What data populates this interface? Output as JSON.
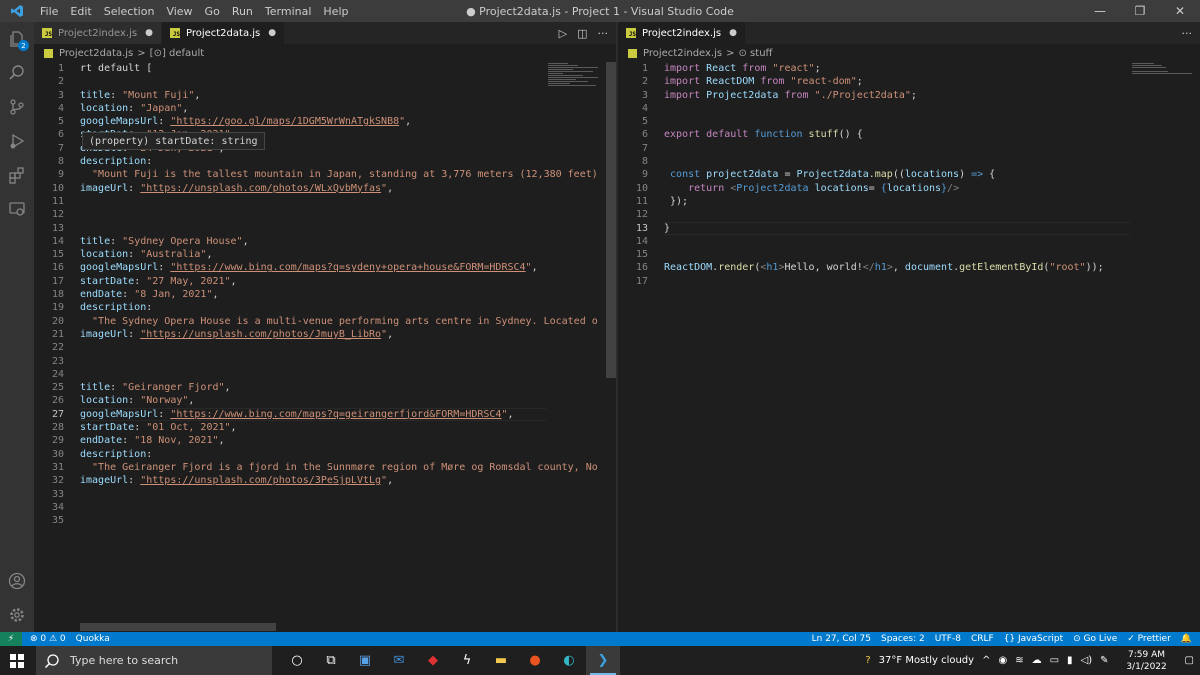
{
  "titlebar": {
    "menu": [
      "File",
      "Edit",
      "Selection",
      "View",
      "Go",
      "Run",
      "Terminal",
      "Help"
    ],
    "title": "● Project2data.js - Project 1 - Visual Studio Code",
    "controls": [
      "—",
      "❐",
      "✕"
    ]
  },
  "activity": {
    "explorer_badge": "2"
  },
  "left": {
    "tabs": [
      {
        "label": "Project2index.js",
        "dirty": "●"
      },
      {
        "label": "Project2data.js",
        "dirty": "●"
      }
    ],
    "actions": [
      "▷",
      "◫",
      "···"
    ],
    "breadcrumb": {
      "file": "Project2data.js",
      "sep": ">",
      "symbol": "[⊙] default"
    },
    "hover": "(property) startDate: string",
    "lines": [
      {
        "n": "1",
        "parts": [
          {
            "c": "p",
            "t": "rt default ["
          }
        ]
      },
      {
        "n": "2",
        "parts": []
      },
      {
        "n": "3",
        "parts": [
          {
            "c": "k",
            "t": "title"
          },
          {
            "c": "p",
            "t": ": "
          },
          {
            "c": "s",
            "t": "\"Mount Fuji\""
          },
          {
            "c": "p",
            "t": ","
          }
        ]
      },
      {
        "n": "4",
        "parts": [
          {
            "c": "k",
            "t": "location"
          },
          {
            "c": "p",
            "t": ": "
          },
          {
            "c": "s",
            "t": "\"Japan\""
          },
          {
            "c": "p",
            "t": ","
          }
        ]
      },
      {
        "n": "5",
        "parts": [
          {
            "c": "k",
            "t": "googleMapsUrl"
          },
          {
            "c": "p",
            "t": ": "
          },
          {
            "c": "u",
            "t": "\"https://goo.gl/maps/1DGM5WrWnATgkSNB8"
          },
          {
            "c": "s",
            "t": "\""
          },
          {
            "c": "p",
            "t": ","
          }
        ]
      },
      {
        "n": "6",
        "parts": [
          {
            "c": "k",
            "t": "startDate"
          },
          {
            "c": "p",
            "t": ": "
          },
          {
            "c": "s",
            "t": "\"12 Jan, 2021\""
          },
          {
            "c": "p",
            "t": ","
          }
        ]
      },
      {
        "n": "7",
        "parts": [
          {
            "c": "k",
            "t": "endDate"
          },
          {
            "c": "p",
            "t": ": "
          },
          {
            "c": "s",
            "t": "\"24 Jan, 2021\""
          },
          {
            "c": "p",
            "t": ","
          }
        ]
      },
      {
        "n": "8",
        "parts": [
          {
            "c": "k",
            "t": "description"
          },
          {
            "c": "p",
            "t": ":"
          }
        ]
      },
      {
        "n": "9",
        "parts": [
          {
            "c": "s",
            "t": "  \"Mount Fuji is the tallest mountain in Japan, standing at 3,776 meters (12,380 feet)"
          }
        ]
      },
      {
        "n": "10",
        "parts": [
          {
            "c": "k",
            "t": "imageUrl"
          },
          {
            "c": "p",
            "t": ": "
          },
          {
            "c": "u",
            "t": "\"https://unsplash.com/photos/WLxQvbMyfas"
          },
          {
            "c": "s",
            "t": "\""
          },
          {
            "c": "p",
            "t": ","
          }
        ]
      },
      {
        "n": "11",
        "parts": []
      },
      {
        "n": "12",
        "parts": []
      },
      {
        "n": "13",
        "parts": []
      },
      {
        "n": "14",
        "parts": [
          {
            "c": "k",
            "t": "title"
          },
          {
            "c": "p",
            "t": ": "
          },
          {
            "c": "s",
            "t": "\"Sydney Opera House\""
          },
          {
            "c": "p",
            "t": ","
          }
        ]
      },
      {
        "n": "15",
        "parts": [
          {
            "c": "k",
            "t": "location"
          },
          {
            "c": "p",
            "t": ": "
          },
          {
            "c": "s",
            "t": "\"Australia\""
          },
          {
            "c": "p",
            "t": ","
          }
        ]
      },
      {
        "n": "16",
        "parts": [
          {
            "c": "k",
            "t": "googleMapsUrl"
          },
          {
            "c": "p",
            "t": ": "
          },
          {
            "c": "u",
            "t": "\"https://www.bing.com/maps?q=sydeny+opera+house&FORM=HDRSC4"
          },
          {
            "c": "s",
            "t": "\""
          },
          {
            "c": "p",
            "t": ","
          }
        ]
      },
      {
        "n": "17",
        "parts": [
          {
            "c": "k",
            "t": "startDate"
          },
          {
            "c": "p",
            "t": ": "
          },
          {
            "c": "s",
            "t": "\"27 May, 2021\""
          },
          {
            "c": "p",
            "t": ","
          }
        ]
      },
      {
        "n": "18",
        "parts": [
          {
            "c": "k",
            "t": "endDate"
          },
          {
            "c": "p",
            "t": ": "
          },
          {
            "c": "s",
            "t": "\"8 Jan, 2021\""
          },
          {
            "c": "p",
            "t": ","
          }
        ]
      },
      {
        "n": "19",
        "parts": [
          {
            "c": "k",
            "t": "description"
          },
          {
            "c": "p",
            "t": ":"
          }
        ]
      },
      {
        "n": "20",
        "parts": [
          {
            "c": "s",
            "t": "  \"The Sydney Opera House is a multi-venue performing arts centre in Sydney. Located o"
          }
        ]
      },
      {
        "n": "21",
        "parts": [
          {
            "c": "k",
            "t": "imageUrl"
          },
          {
            "c": "p",
            "t": ": "
          },
          {
            "c": "u",
            "t": "\"https://unsplash.com/photos/JmuyB_LibRo"
          },
          {
            "c": "s",
            "t": "\""
          },
          {
            "c": "p",
            "t": ","
          }
        ]
      },
      {
        "n": "22",
        "parts": []
      },
      {
        "n": "23",
        "parts": []
      },
      {
        "n": "24",
        "parts": []
      },
      {
        "n": "25",
        "parts": [
          {
            "c": "k",
            "t": "title"
          },
          {
            "c": "p",
            "t": ": "
          },
          {
            "c": "s",
            "t": "\"Geiranger Fjord\""
          },
          {
            "c": "p",
            "t": ","
          }
        ]
      },
      {
        "n": "26",
        "parts": [
          {
            "c": "k",
            "t": "location"
          },
          {
            "c": "p",
            "t": ": "
          },
          {
            "c": "s",
            "t": "\"Norway\""
          },
          {
            "c": "p",
            "t": ","
          }
        ]
      },
      {
        "n": "27",
        "parts": [
          {
            "c": "k",
            "t": "googleMapsUrl"
          },
          {
            "c": "p",
            "t": ": "
          },
          {
            "c": "u",
            "t": "\"https://www.bing.com/maps?q=geirangerfjord&FORM=HDRSC4"
          },
          {
            "c": "s",
            "t": "\""
          },
          {
            "c": "p",
            "t": ","
          }
        ]
      },
      {
        "n": "28",
        "parts": [
          {
            "c": "k",
            "t": "startDate"
          },
          {
            "c": "p",
            "t": ": "
          },
          {
            "c": "s",
            "t": "\"01 Oct, 2021\""
          },
          {
            "c": "p",
            "t": ","
          }
        ]
      },
      {
        "n": "29",
        "parts": [
          {
            "c": "k",
            "t": "endDate"
          },
          {
            "c": "p",
            "t": ": "
          },
          {
            "c": "s",
            "t": "\"18 Nov, 2021\""
          },
          {
            "c": "p",
            "t": ","
          }
        ]
      },
      {
        "n": "30",
        "parts": [
          {
            "c": "k",
            "t": "description"
          },
          {
            "c": "p",
            "t": ":"
          }
        ]
      },
      {
        "n": "31",
        "parts": [
          {
            "c": "s",
            "t": "  \"The Geiranger Fjord is a fjord in the Sunnmøre region of Møre og Romsdal county, No"
          }
        ]
      },
      {
        "n": "32",
        "parts": [
          {
            "c": "k",
            "t": "imageUrl"
          },
          {
            "c": "p",
            "t": ": "
          },
          {
            "c": "u",
            "t": "\"https://unsplash.com/photos/3PeSjpLVtLg"
          },
          {
            "c": "s",
            "t": "\""
          },
          {
            "c": "p",
            "t": ","
          }
        ]
      },
      {
        "n": "33",
        "parts": []
      },
      {
        "n": "34",
        "parts": []
      },
      {
        "n": "35",
        "parts": []
      }
    ],
    "current_line": "27"
  },
  "right": {
    "tabs": [
      {
        "label": "Project2index.js",
        "dirty": "●"
      }
    ],
    "actions": [
      "···"
    ],
    "breadcrumb": {
      "file": "Project2index.js",
      "sep": ">",
      "symbol": "⊙ stuff"
    },
    "lines": [
      {
        "n": "1",
        "parts": [
          {
            "c": "kc",
            "t": "import"
          },
          {
            "c": "p",
            "t": " "
          },
          {
            "c": "k",
            "t": "React"
          },
          {
            "c": "p",
            "t": " "
          },
          {
            "c": "kc",
            "t": "from"
          },
          {
            "c": "p",
            "t": " "
          },
          {
            "c": "s",
            "t": "\"react\""
          },
          {
            "c": "p",
            "t": ";"
          }
        ]
      },
      {
        "n": "2",
        "parts": [
          {
            "c": "kc",
            "t": "import"
          },
          {
            "c": "p",
            "t": " "
          },
          {
            "c": "k",
            "t": "ReactDOM"
          },
          {
            "c": "p",
            "t": " "
          },
          {
            "c": "kc",
            "t": "from"
          },
          {
            "c": "p",
            "t": " "
          },
          {
            "c": "s",
            "t": "\"react-dom\""
          },
          {
            "c": "p",
            "t": ";"
          }
        ]
      },
      {
        "n": "3",
        "parts": [
          {
            "c": "kc",
            "t": "import"
          },
          {
            "c": "p",
            "t": " "
          },
          {
            "c": "k",
            "t": "Project2data"
          },
          {
            "c": "p",
            "t": " "
          },
          {
            "c": "kc",
            "t": "from"
          },
          {
            "c": "p",
            "t": " "
          },
          {
            "c": "s",
            "t": "\"./Project2data\""
          },
          {
            "c": "p",
            "t": ";"
          }
        ]
      },
      {
        "n": "4",
        "parts": []
      },
      {
        "n": "5",
        "parts": []
      },
      {
        "n": "6",
        "parts": [
          {
            "c": "kc",
            "t": "export"
          },
          {
            "c": "p",
            "t": " "
          },
          {
            "c": "kc",
            "t": "default"
          },
          {
            "c": "p",
            "t": " "
          },
          {
            "c": "kw",
            "t": "function"
          },
          {
            "c": "p",
            "t": " "
          },
          {
            "c": "fn",
            "t": "stuff"
          },
          {
            "c": "p",
            "t": "() {"
          }
        ]
      },
      {
        "n": "7",
        "parts": []
      },
      {
        "n": "8",
        "parts": []
      },
      {
        "n": "9",
        "parts": [
          {
            "c": "p",
            "t": " "
          },
          {
            "c": "kw",
            "t": "const"
          },
          {
            "c": "p",
            "t": " "
          },
          {
            "c": "k",
            "t": "project2data"
          },
          {
            "c": "p",
            "t": " = "
          },
          {
            "c": "k",
            "t": "Project2data"
          },
          {
            "c": "p",
            "t": "."
          },
          {
            "c": "fn",
            "t": "map"
          },
          {
            "c": "p",
            "t": "(("
          },
          {
            "c": "k",
            "t": "locations"
          },
          {
            "c": "p",
            "t": ") "
          },
          {
            "c": "kw",
            "t": "=>"
          },
          {
            "c": "p",
            "t": " {"
          }
        ]
      },
      {
        "n": "10",
        "parts": [
          {
            "c": "p",
            "t": "    "
          },
          {
            "c": "kc",
            "t": "return"
          },
          {
            "c": "p",
            "t": " "
          },
          {
            "c": "tg",
            "t": "<"
          },
          {
            "c": "tn",
            "t": "Project2data"
          },
          {
            "c": "p",
            "t": " "
          },
          {
            "c": "k",
            "t": "locations"
          },
          {
            "c": "p",
            "t": "= "
          },
          {
            "c": "kw",
            "t": "{"
          },
          {
            "c": "k",
            "t": "locations"
          },
          {
            "c": "kw",
            "t": "}"
          },
          {
            "c": "tg",
            "t": "/>"
          }
        ]
      },
      {
        "n": "11",
        "parts": [
          {
            "c": "p",
            "t": " });"
          }
        ]
      },
      {
        "n": "12",
        "parts": []
      },
      {
        "n": "13",
        "parts": [
          {
            "c": "p",
            "t": "}"
          }
        ]
      },
      {
        "n": "14",
        "parts": []
      },
      {
        "n": "15",
        "parts": []
      },
      {
        "n": "16",
        "parts": [
          {
            "c": "k",
            "t": "ReactDOM"
          },
          {
            "c": "p",
            "t": "."
          },
          {
            "c": "fn",
            "t": "render"
          },
          {
            "c": "p",
            "t": "("
          },
          {
            "c": "tg",
            "t": "<"
          },
          {
            "c": "tn",
            "t": "h1"
          },
          {
            "c": "tg",
            "t": ">"
          },
          {
            "c": "p",
            "t": "Hello, world!"
          },
          {
            "c": "tg",
            "t": "</"
          },
          {
            "c": "tn",
            "t": "h1"
          },
          {
            "c": "tg",
            "t": ">"
          },
          {
            "c": "p",
            "t": ", "
          },
          {
            "c": "k",
            "t": "document"
          },
          {
            "c": "p",
            "t": "."
          },
          {
            "c": "fn",
            "t": "getElementById"
          },
          {
            "c": "p",
            "t": "("
          },
          {
            "c": "s",
            "t": "\"root\""
          },
          {
            "c": "p",
            "t": "));"
          }
        ]
      },
      {
        "n": "17",
        "parts": []
      }
    ],
    "current_line": "13"
  },
  "statusbar": {
    "remote": "⚡",
    "left": [
      "⊗ 0 ⚠ 0",
      "Quokka"
    ],
    "right": [
      "Ln 27, Col 75",
      "Spaces: 2",
      "UTF-8",
      "CRLF",
      "{} JavaScript",
      "⊙ Go Live",
      "✓ Prettier",
      "🔔"
    ]
  },
  "taskbar": {
    "search_placeholder": "Type here to search",
    "weather": "37°F  Mostly cloudy",
    "time": "7:59 AM",
    "date": "3/1/2022"
  },
  "colors": {
    "accent": "#007acc",
    "editor_bg": "#1e1e1e",
    "remote": "#16825d"
  }
}
